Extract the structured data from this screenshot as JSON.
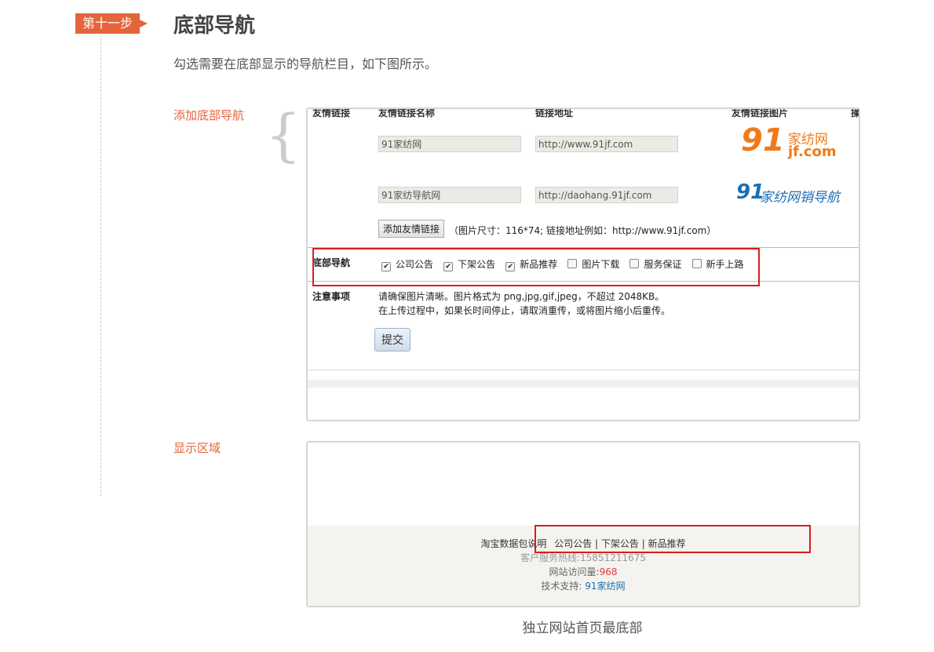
{
  "step": {
    "tag": "第十一步",
    "title": "底部导航",
    "description": "勾选需要在底部显示的导航栏目，如下图所示。"
  },
  "labels": {
    "add": "添加底部导航",
    "display": "显示区域"
  },
  "panel1": {
    "headers": [
      "友情链接",
      "友情链接名称",
      "链接地址",
      "友情链接图片",
      "操"
    ],
    "links": [
      {
        "name": "91家纺网",
        "url": "http://www.91jf.com",
        "logo_big": "91",
        "logo_cn": "家纺网",
        "logo_en": "jf.com"
      },
      {
        "name": "91家纺导航网",
        "url": "http://daohang.91jf.com",
        "logo_big": "91",
        "logo_cn": "家纺网销导航"
      }
    ],
    "add_button": "添加友情链接",
    "add_tip": "（图片尺寸：116*74; 链接地址例如：http://www.91jf.com）",
    "nav_label": "底部导航",
    "nav_options": [
      {
        "label": "公司公告",
        "checked": true
      },
      {
        "label": "下架公告",
        "checked": true
      },
      {
        "label": "新品推荐",
        "checked": true
      },
      {
        "label": "图片下载",
        "checked": false
      },
      {
        "label": "服务保证",
        "checked": false
      },
      {
        "label": "新手上路",
        "checked": false
      }
    ],
    "notice_label": "注意事项",
    "notice_lines": [
      "请确保图片清晰。图片格式为 png,jpg,gif,jpeg，不超过 2048KB。",
      "在上传过程中，如果长时间停止，请取消重传，或将图片缩小后重传。"
    ],
    "submit": "提交"
  },
  "panel2": {
    "footer_left": "淘宝数据包说明",
    "footer_links": [
      "公司公告",
      "下架公告",
      "新品推荐"
    ],
    "sep": "|",
    "hotline": "客户服务热线:15851211675",
    "visits_label": "网站访问量:",
    "visits": "968",
    "support_label": "技术支持:",
    "support_link": "91家纺网"
  },
  "caption": "独立网站首页最底部",
  "colors": {
    "accent": "#e4643c",
    "highlight": "#d41f1f",
    "logo_orange": "#f07a1a",
    "logo_blue": "#1b6fb3"
  }
}
